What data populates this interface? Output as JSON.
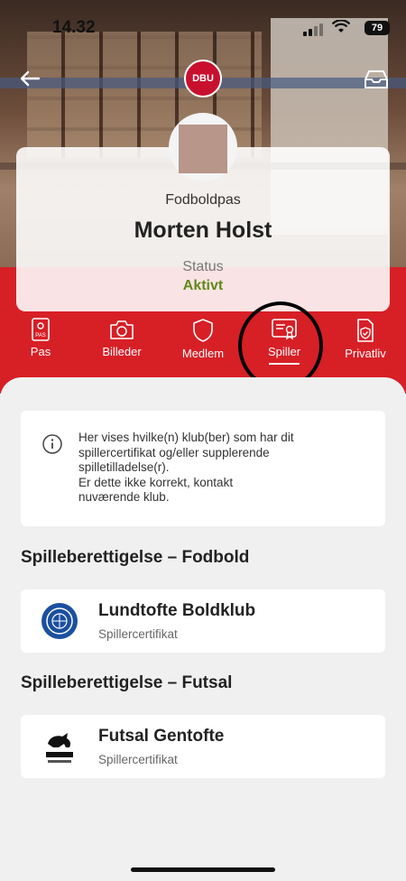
{
  "status_bar": {
    "time": "14.32",
    "battery": "79"
  },
  "header": {
    "logo_text": "DBU"
  },
  "profile": {
    "pass_title": "Fodboldpas",
    "name": "Morten Holst",
    "status_label": "Status",
    "status_value": "Aktivt"
  },
  "tabs": [
    {
      "label": "Pas",
      "icon": "passport-icon"
    },
    {
      "label": "Billeder",
      "icon": "camera-icon"
    },
    {
      "label": "Medlem",
      "icon": "shield-icon"
    },
    {
      "label": "Spiller",
      "icon": "certificate-icon",
      "active": true
    },
    {
      "label": "Privatliv",
      "icon": "shield-check-icon"
    }
  ],
  "info": {
    "lines": [
      "Her vises hvilke(n) klub(ber) som har dit",
      "spillercertifikat og/eller supplerende",
      "spilletilladelse(r).",
      "Er dette ikke korrekt, kontakt",
      "nuværende klub."
    ]
  },
  "sections": [
    {
      "title": "Spilleberettigelse – Fodbold",
      "club": {
        "name": "Lundtofte Boldklub",
        "subtitle": "Spillercertifikat"
      }
    },
    {
      "title": "Spilleberettigelse – Futsal",
      "club": {
        "name": "Futsal Gentofte",
        "subtitle": "Spillercertifikat"
      }
    }
  ],
  "colors": {
    "brand_red": "#d71f26",
    "status_green": "#5f8a1a"
  }
}
